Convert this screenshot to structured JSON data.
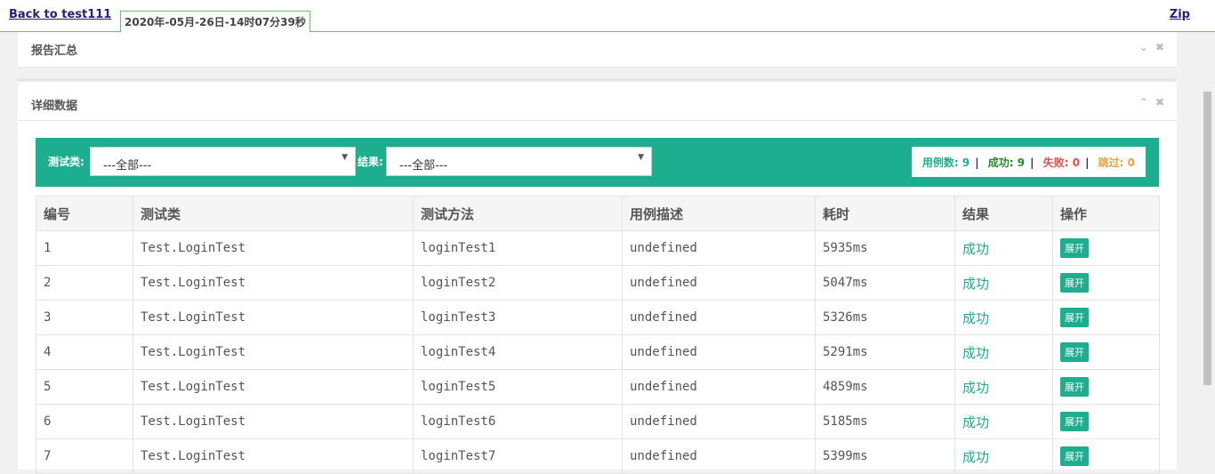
{
  "topbar": {
    "back_label": "Back to test111",
    "timestamp": "2020年-05月-26日-14时07分39秒",
    "zip_label": "Zip"
  },
  "summary_panel": {
    "title": "报告汇总"
  },
  "detail_panel": {
    "title": "详细数据",
    "filters": {
      "class_label": "测试类:",
      "class_value": "---全部---",
      "result_label": "结果:",
      "result_value": "---全部---"
    },
    "stats": {
      "total_label": "用例数:",
      "total": "9",
      "pass_label": "成功:",
      "pass": "9",
      "fail_label": "失败:",
      "fail": "0",
      "skip_label": "跳过:",
      "skip": "0",
      "colors": {
        "total": "#1cae8e",
        "pass": "#2a8a2a",
        "fail": "#e05050",
        "skip": "#f0a040"
      }
    },
    "table": {
      "headers": [
        "编号",
        "测试类",
        "测试方法",
        "用例描述",
        "耗时",
        "结果",
        "操作"
      ],
      "rows": [
        [
          "1",
          "Test.LoginTest",
          "loginTest1",
          "undefined",
          "5935ms",
          "成功",
          "展开"
        ],
        [
          "2",
          "Test.LoginTest",
          "loginTest2",
          "undefined",
          "5047ms",
          "成功",
          "展开"
        ],
        [
          "3",
          "Test.LoginTest",
          "loginTest3",
          "undefined",
          "5326ms",
          "成功",
          "展开"
        ],
        [
          "4",
          "Test.LoginTest",
          "loginTest4",
          "undefined",
          "5291ms",
          "成功",
          "展开"
        ],
        [
          "5",
          "Test.LoginTest",
          "loginTest5",
          "undefined",
          "4859ms",
          "成功",
          "展开"
        ],
        [
          "6",
          "Test.LoginTest",
          "loginTest6",
          "undefined",
          "5185ms",
          "成功",
          "展开"
        ],
        [
          "7",
          "Test.LoginTest",
          "loginTest7",
          "undefined",
          "5399ms",
          "成功",
          "展开"
        ]
      ]
    }
  },
  "icons": {
    "collapse": "chevron-down-icon",
    "expand": "chevron-up-icon",
    "close": "close-icon"
  }
}
